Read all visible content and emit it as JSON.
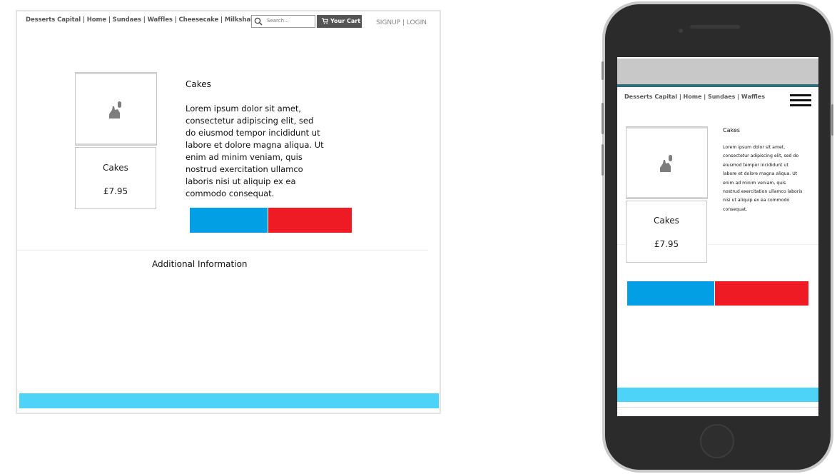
{
  "desktop": {
    "nav": "Desserts Capital | Home | Sundaes | Waffles | Cheesecake | Milkshakes | Cakes",
    "search": {
      "placeholder": "Search..."
    },
    "cart_label": "Your Cart",
    "auth": "SIGNUP | LOGIN",
    "product": {
      "card_name": "Cakes",
      "card_price": "£7.95",
      "title": "Cakes",
      "description": "Lorem ipsum dolor sit amet, consectetur adipiscing elit, sed do eiusmod tempor incididunt ut labore et dolore magna aliqua. Ut enim ad minim veniam, quis nostrud exercitation ullamco laboris nisi ut aliquip ex ea commodo consequat."
    },
    "additional_info": "Additional Information"
  },
  "mobile": {
    "nav": "Desserts Capital | Home | Sundaes | Waffles",
    "product": {
      "title": "Cakes",
      "description": "Lorem ipsum dolor sit amet, consectetur adipiscing elit, sed do eiusmod tempor incididunt ut labore et dolore magna aliqua. Ut enim ad minim veniam, quis nostrud exercitation ullamco laboris nisi ut aliquip ex ea commodo consequat.",
      "card_name": "Cakes",
      "card_price": "£7.95"
    }
  },
  "icons": {
    "search": "search-icon",
    "cart": "cart-icon",
    "image_placeholder": "image-placeholder-icon",
    "menu": "hamburger-menu-icon"
  },
  "colors": {
    "primary_button": "#039fe5",
    "secondary_button": "#ef1b24",
    "footer": "#4dd3f7",
    "cart_button": "#555555"
  }
}
